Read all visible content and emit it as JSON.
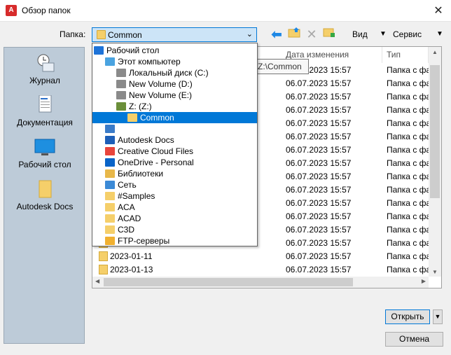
{
  "window": {
    "title": "Обзор папок",
    "app_icon": "A"
  },
  "toolbar": {
    "folder_label": "Папка:",
    "folder_value": "Common",
    "view_label": "Вид",
    "service_label": "Сервис"
  },
  "places": [
    {
      "label": "Журнал",
      "icon": "history-icon"
    },
    {
      "label": "Документация",
      "icon": "document-icon"
    },
    {
      "label": "Рабочий стол",
      "icon": "desktop-icon"
    },
    {
      "label": "Autodesk Docs",
      "icon": "folder-icon"
    }
  ],
  "list": {
    "columns": [
      "Дата изменения",
      "Тип"
    ],
    "rows": [
      {
        "name": "",
        "date": "06.07.2023 15:57",
        "type": "Папка с фай"
      },
      {
        "name": "",
        "date": "06.07.2023 15:57",
        "type": "Папка с фай"
      },
      {
        "name": "",
        "date": "06.07.2023 15:57",
        "type": "Папка с фай"
      },
      {
        "name": "",
        "date": "06.07.2023 15:57",
        "type": "Папка с фай"
      },
      {
        "name": "",
        "date": "06.07.2023 15:57",
        "type": "Папка с фай"
      },
      {
        "name": "",
        "date": "06.07.2023 15:57",
        "type": "Папка с фай"
      },
      {
        "name": "",
        "date": "06.07.2023 15:57",
        "type": "Папка с фай"
      },
      {
        "name": "",
        "date": "06.07.2023 15:57",
        "type": "Папка с фай"
      },
      {
        "name": "",
        "date": "06.07.2023 15:57",
        "type": "Папка с фай"
      },
      {
        "name": "",
        "date": "06.07.2023 15:57",
        "type": "Папка с фай"
      },
      {
        "name": "",
        "date": "06.07.2023 15:57",
        "type": "Папка с фай"
      },
      {
        "name": "",
        "date": "06.07.2023 15:57",
        "type": "Папка с фай"
      },
      {
        "name": "",
        "date": "06.07.2023 15:57",
        "type": "Папка с фай"
      },
      {
        "name": "",
        "date": "06.07.2023 15:57",
        "type": "Папка с фай"
      },
      {
        "name": "2023-01-11",
        "date": "06.07.2023 15:57",
        "type": "Папка с фай"
      },
      {
        "name": "2023-01-13",
        "date": "06.07.2023 15:57",
        "type": "Папка с фай"
      }
    ]
  },
  "tooltip": "Z:\\Common",
  "dropdown": [
    {
      "label": "Рабочий стол",
      "level": 0,
      "icon": "desktop-icon",
      "color": "#1e73d8"
    },
    {
      "label": "Этот компьютер",
      "level": 1,
      "icon": "computer-icon",
      "color": "#4aa3e0"
    },
    {
      "label": "Локальный диск (C:)",
      "level": 2,
      "icon": "drive-icon",
      "color": "#8a8a8a"
    },
    {
      "label": "New Volume (D:)",
      "level": 2,
      "icon": "drive-icon",
      "color": "#8a8a8a"
    },
    {
      "label": "New Volume (E:)",
      "level": 2,
      "icon": "drive-icon",
      "color": "#8a8a8a"
    },
    {
      "label": "Z: (Z:)",
      "level": 2,
      "icon": "network-drive-icon",
      "color": "#6b8f3a"
    },
    {
      "label": "Common",
      "level": 3,
      "icon": "folder-icon",
      "color": "#f5cf6a",
      "selected": true
    },
    {
      "label": "",
      "level": 1,
      "icon": "user-icon",
      "color": "#3a7bc8"
    },
    {
      "label": "Autodesk Docs",
      "level": 1,
      "icon": "docs-icon",
      "color": "#1d5fb8"
    },
    {
      "label": "Creative Cloud Files",
      "level": 1,
      "icon": "creative-cloud-icon",
      "color": "#e8453c"
    },
    {
      "label": "OneDrive - Personal",
      "level": 1,
      "icon": "onedrive-icon",
      "color": "#0a64c8"
    },
    {
      "label": "Библиотеки",
      "level": 1,
      "icon": "libraries-icon",
      "color": "#e8b84a"
    },
    {
      "label": "Сеть",
      "level": 1,
      "icon": "network-icon",
      "color": "#3c8ad6"
    },
    {
      "label": "#Samples",
      "level": 1,
      "icon": "folder-icon",
      "color": "#f5cf6a"
    },
    {
      "label": "ACA",
      "level": 1,
      "icon": "folder-icon",
      "color": "#f5cf6a"
    },
    {
      "label": "ACAD",
      "level": 1,
      "icon": "folder-icon",
      "color": "#f5cf6a"
    },
    {
      "label": "C3D",
      "level": 1,
      "icon": "folder-icon",
      "color": "#f5cf6a"
    },
    {
      "label": "FTP-серверы",
      "level": 1,
      "icon": "ftp-icon",
      "color": "#f0b030"
    }
  ],
  "buttons": {
    "open": "Открыть",
    "cancel": "Отмена"
  },
  "colors": {
    "accent": "#0078d7",
    "selection": "#0078d7",
    "places_bg": "#bdcbd8"
  }
}
